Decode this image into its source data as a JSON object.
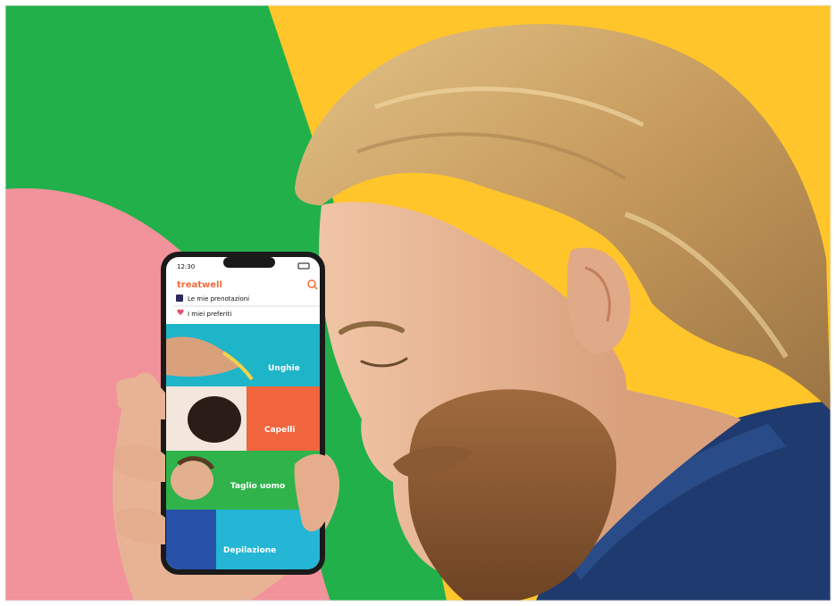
{
  "colors": {
    "bg_green": "#22b04b",
    "bg_yellow": "#ffc52a",
    "bg_pink": "#f2929b",
    "shirt_blue": "#1f3a6e",
    "hair_blond": "#c9a267",
    "skin": "#e8b898",
    "beard": "#8a5a34",
    "phone_frame": "#1a1a1a",
    "brand_orange": "#f26a3d",
    "tile_teal": "#1fb5c9",
    "tile_orange": "#f0653d",
    "tile_green": "#2fb34a",
    "tile_cyan": "#24b6d4"
  },
  "phone": {
    "status_time": "12:30",
    "brand": "treatwell",
    "menu": [
      {
        "label": "Le mie prenotazioni",
        "icon": "calendar-icon"
      },
      {
        "label": "I miei preferiti",
        "icon": "heart-icon"
      }
    ],
    "tiles": [
      {
        "label": "Unghie"
      },
      {
        "label": "Capelli"
      },
      {
        "label": "Taglio uomo"
      },
      {
        "label": "Depilazione"
      }
    ]
  }
}
